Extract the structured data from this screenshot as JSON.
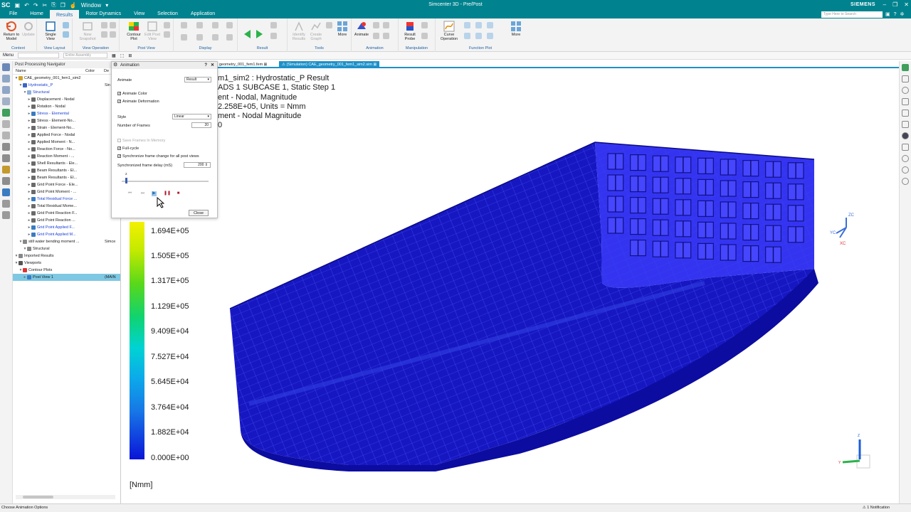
{
  "app": {
    "logo": "SC",
    "window_title": "Simcenter 3D - Pre/Post",
    "brand": "SIEMENS",
    "window_menu": "Window",
    "search_placeholder": "Type Here to Search"
  },
  "menu": [
    "File",
    "Home",
    "Results",
    "Rotor Dynamics",
    "View",
    "Selection",
    "Application"
  ],
  "menu_active": "Results",
  "ribbon": {
    "groups": [
      "Context",
      "View Layout",
      "View Operation",
      "Post View",
      "Display",
      "Result",
      "Tools",
      "Animation",
      "Manipulation",
      "Function Plot"
    ],
    "buttons": {
      "return_to_model": "Return to Model",
      "update": "Update",
      "single_view": "Single View",
      "new_snapshot": "New Snapshot",
      "contour_plot": "Contour Plot",
      "edit_post_view": "Edit Post View",
      "more": "More",
      "identify_results": "Identify Results",
      "create_graph": "Create Graph",
      "animate": "Animate",
      "result_probe": "Result Probe",
      "curve_operation": "Curve Operation"
    }
  },
  "toolbar2": {
    "menu": "Menu",
    "filter_placeholder": "Entire Assembly"
  },
  "tabs": [
    "geometry_001_fem1.fem",
    "(Simulation) CAE_geometry_001_fem1_sim2.sim"
  ],
  "navigator": {
    "title": "Post Processing Navigator",
    "columns": [
      "Name",
      "Color",
      "De"
    ],
    "rows": [
      {
        "label": "CAE_geometry_001_fem1_sim2",
        "extra": ""
      },
      {
        "label": "Hydrostatic_P",
        "extra": "Sin"
      },
      {
        "label": "Structural",
        "extra": ""
      },
      {
        "label": "Displacement - Nodal",
        "extra": ""
      },
      {
        "label": "Rotation - Nodal",
        "extra": ""
      },
      {
        "label": "Stress - Elemental",
        "extra": ""
      },
      {
        "label": "Stress - Element-No...",
        "extra": ""
      },
      {
        "label": "Strain - Element-No...",
        "extra": ""
      },
      {
        "label": "Applied Force - Nodal",
        "extra": ""
      },
      {
        "label": "Applied Moment - N...",
        "extra": ""
      },
      {
        "label": "Reaction Force - No...",
        "extra": ""
      },
      {
        "label": "Reaction Moment - ...",
        "extra": ""
      },
      {
        "label": "Shell Resultants - Ele...",
        "extra": ""
      },
      {
        "label": "Beam Resultants - El...",
        "extra": ""
      },
      {
        "label": "Beam Resultants - El...",
        "extra": ""
      },
      {
        "label": "Grid Point Force - Ele...",
        "extra": ""
      },
      {
        "label": "Grid Point Moment - ...",
        "extra": ""
      },
      {
        "label": "Total Residual Force ...",
        "extra": ""
      },
      {
        "label": "Total Residual Mome...",
        "extra": ""
      },
      {
        "label": "Grid Point Reaction F...",
        "extra": ""
      },
      {
        "label": "Grid Point Reaction ...",
        "extra": ""
      },
      {
        "label": "Grid Point Applied F...",
        "extra": ""
      },
      {
        "label": "Grid Point Applied M...",
        "extra": ""
      },
      {
        "label": "still water bending moment ...",
        "extra": "Simce"
      },
      {
        "label": "Structural",
        "extra": ""
      },
      {
        "label": "Imported Results",
        "extra": ""
      },
      {
        "label": "Viewports",
        "extra": ""
      },
      {
        "label": "Contour Plots",
        "extra": ""
      },
      {
        "label": "Post View 1",
        "extra": "(MAIN"
      }
    ]
  },
  "dialog": {
    "title": "Animation",
    "animate_label": "Animate",
    "animate_value": "Result",
    "animate_color": "Animate Color",
    "animate_deformation": "Animate Deformation",
    "style_label": "Style",
    "style_value": "Linear",
    "frames_label": "Number of Frames",
    "frames_value": "20",
    "save_frames": "Save Frames In Memory",
    "full_cycle": "Full-cycle",
    "sync_frame": "Synchronize frame change for all post views",
    "delay_label": "Synchronized frame delay (mS)",
    "delay_value": "200",
    "slider_value": "2",
    "close": "Close"
  },
  "result": {
    "lines": [
      "m1_sim2 : Hydrostatic_P Result",
      "ADS 1 SUBCASE 1, Static Step 1",
      "ent - Nodal, Magnitude",
      "2.258E+05, Units = Nmm",
      "ment - Nodal Magnitude",
      "0"
    ],
    "legend": [
      "1.694E+05",
      "1.505E+05",
      "1.317E+05",
      "1.129E+05",
      "9.409E+04",
      "7.527E+04",
      "5.645E+04",
      "3.764E+04",
      "1.882E+04",
      "0.000E+00"
    ],
    "unit": "[Nmm]",
    "triad_labels": [
      "ZC",
      "YC",
      "XC"
    ]
  },
  "status": {
    "left": "Choose Animation Options",
    "right": "1 Notification"
  }
}
